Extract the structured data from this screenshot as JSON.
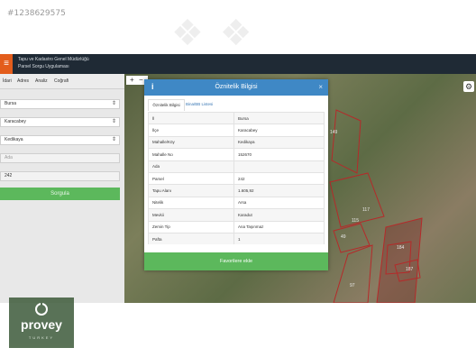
{
  "listing_id": "#1238629575",
  "app": {
    "header_line1": "Tapu ve Kadastro Genel Müdürlüğü",
    "header_line2": "Parsel Sorgu Uygulaması",
    "panel_tabs": [
      "İdari",
      "Adres",
      "Analiz",
      "Coğrafi"
    ],
    "fields": [
      {
        "value": "Bursa"
      },
      {
        "value": "Karacabey"
      },
      {
        "value": "Kedikaya"
      },
      {
        "placeholder": "Ada"
      },
      {
        "value": "242"
      }
    ],
    "search_button": "Sorgula"
  },
  "map": {
    "zoom_in": "+",
    "zoom_out": "−",
    "parcel_labels": [
      "149",
      "117",
      "115",
      "49",
      "184",
      "187",
      "97"
    ]
  },
  "modal": {
    "title": "Öznitelik Bilgisi",
    "info_icon": "i",
    "close_icon": "×",
    "tabs": [
      "Öznitelik Bilgisi",
      "Bina/BB Listesi"
    ],
    "rows": [
      [
        "İl",
        "Bursa"
      ],
      [
        "İlçe",
        "Karacabey"
      ],
      [
        "Mahalle/Köy",
        "Kedikaya"
      ],
      [
        "Mahalle No",
        "152670"
      ],
      [
        "Ada",
        ""
      ],
      [
        "Parsel",
        "242"
      ],
      [
        "Tapu Alanı",
        "1.605,92"
      ],
      [
        "Nitelik",
        "Arsa"
      ],
      [
        "Mevkii",
        "Karadut"
      ],
      [
        "Zemin Tip",
        "Ana Taşınmaz"
      ],
      [
        "Pafta",
        "1"
      ]
    ],
    "favorite_button": "Favorilere ekle"
  },
  "logo": {
    "name": "provey",
    "sub": "TURKEY"
  },
  "colors": {
    "header": "#1f2a35",
    "accent_orange": "#e35d1c",
    "modal_blue": "#3f88c5",
    "green_button": "#5cb85c"
  }
}
